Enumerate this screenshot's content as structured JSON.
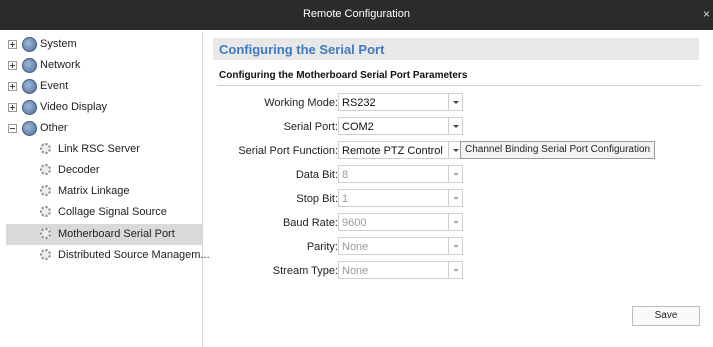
{
  "window": {
    "title": "Remote Configuration",
    "close_symbol": "×"
  },
  "sidebar": {
    "items": [
      {
        "label": "System",
        "icon": "globe-icon",
        "expander": "plus"
      },
      {
        "label": "Network",
        "icon": "globe-icon",
        "expander": "plus"
      },
      {
        "label": "Event",
        "icon": "globe-icon",
        "expander": "plus"
      },
      {
        "label": "Video Display",
        "icon": "globe-icon",
        "expander": "plus"
      },
      {
        "label": "Other",
        "icon": "globe-icon",
        "expander": "minus"
      },
      {
        "label": "Link RSC Server",
        "icon": "gear-icon"
      },
      {
        "label": "Decoder",
        "icon": "gear-icon"
      },
      {
        "label": "Matrix Linkage",
        "icon": "gear-icon"
      },
      {
        "label": "Collage Signal Source",
        "icon": "gear-icon"
      },
      {
        "label": "Motherboard Serial Port",
        "icon": "gear-icon",
        "selected": true
      },
      {
        "label": "Distributed Source Managem...",
        "icon": "gear-icon"
      }
    ]
  },
  "main": {
    "header": "Configuring the Serial Port",
    "subheading": "Configuring the Motherboard Serial Port Parameters",
    "fields": [
      {
        "label": "Working Mode:",
        "value": "RS232",
        "enabled": true
      },
      {
        "label": "Serial Port:",
        "value": "COM2",
        "enabled": true
      },
      {
        "label": "Serial Port Function:",
        "value": "Remote PTZ Control",
        "enabled": true
      },
      {
        "label": "Data Bit:",
        "value": "8",
        "enabled": false
      },
      {
        "label": "Stop Bit:",
        "value": "1",
        "enabled": false
      },
      {
        "label": "Baud Rate:",
        "value": "9600",
        "enabled": false
      },
      {
        "label": "Parity:",
        "value": "None",
        "enabled": false
      },
      {
        "label": "Stream Type:",
        "value": "None",
        "enabled": false
      }
    ],
    "channel_binding_button": "Channel Binding Serial Port Configuration",
    "save_button": "Save"
  },
  "colors": {
    "titlebar": "#2b2b2b",
    "header_text": "#3f7ac0",
    "selected_row": "#d9d9d9"
  }
}
